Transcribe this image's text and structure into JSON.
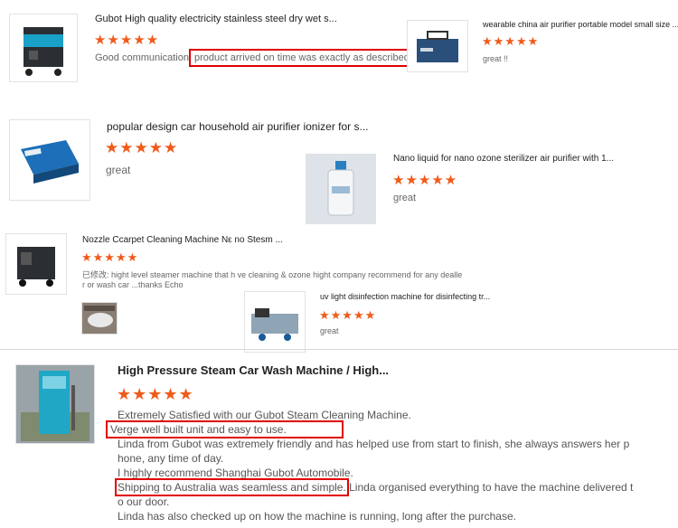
{
  "reviews": [
    {
      "title": "Gubot High quality electricity stainless steel dry wet s...",
      "stars": "★★★★★",
      "text_a": "Good communication,",
      "text_b": "product arrived on time was exactly as described"
    },
    {
      "title": "wearable china air purifier portable model small size ...",
      "stars": "★★★★★",
      "text": "great !!"
    },
    {
      "title": "popular design car household air purifier ionizer for s...",
      "stars": "★★★★★",
      "text": "great"
    },
    {
      "title": "Nano liquid for nano ozone sterilizer air purifier with 1...",
      "stars": "★★★★★",
      "text": "great"
    },
    {
      "title": "Nozzle Ccarpet Cleaning Machine Nε no Stesm ...",
      "stars": "★★★★★",
      "text_line1": "已修改: hight level steamer machine that h ve cleaning & ozone hight company recommend for any dealle",
      "text_line2": "r or wash car ...thanks Echo"
    },
    {
      "title": "uv light disinfection machine for disinfecting tr...",
      "stars": "★★★★★",
      "text": "great"
    }
  ],
  "featured": {
    "title": "High Pressure Steam Car Wash Machine / High...",
    "stars": "★★★★★",
    "lines": [
      "Extremely Satisfied with our Gubot Steam Cleaning Machine.",
      "Verge well built unit and easy to use.",
      "Linda from Gubot was extremely friendly and has helped use from start to finish, she always answers her p",
      "hone, any time of day.",
      "I highly recommend Shanghai Gubot Automobile.",
      "Shipping to Australia was seamless and simple.",
      " Linda organised everything to have the machine delivered t",
      "o our door.",
      "Linda has also checked up on how the machine is running, long after the purchase."
    ]
  },
  "icons": {
    "star": "star-icon",
    "product": "product-image"
  }
}
